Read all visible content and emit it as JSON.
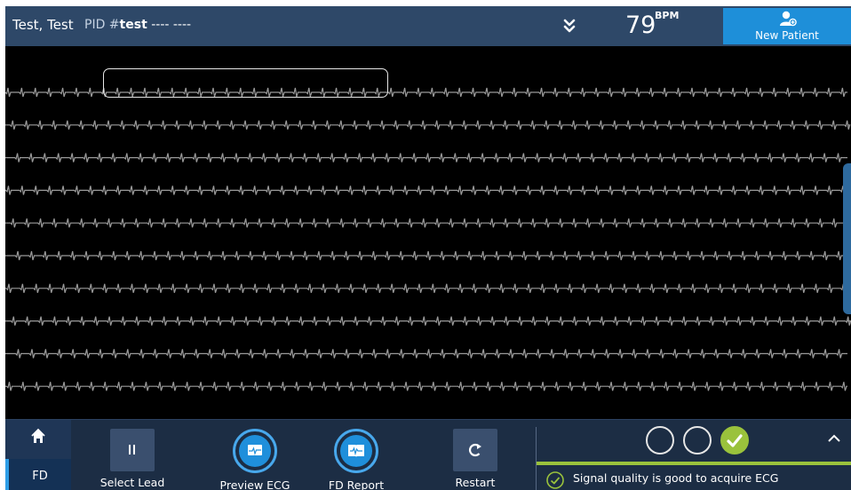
{
  "header": {
    "patient_name": "Test, Test",
    "pid_label": "PID #",
    "pid_value": "test",
    "pid_placeholder": " ---- ----",
    "heart_rate": "79",
    "heart_rate_unit": "BPM",
    "new_patient_label": "New Patient"
  },
  "ecg": {
    "lead_count": 10,
    "trace_color": "#9a9a9a"
  },
  "toolbar": {
    "fd_label": "FD",
    "select_lead_label": "Select Lead",
    "preview_ecg_label": "Preview ECG",
    "fd_report_label": "FD Report",
    "restart_label": "Restart"
  },
  "signal_quality": {
    "message": "Signal quality is good to acquire ECG",
    "indicators": [
      "empty",
      "empty",
      "good"
    ],
    "good_color": "#9ac23c"
  },
  "colors": {
    "header_bg": "#2e4868",
    "accent": "#1e8fd9",
    "toolbar_bg": "#1c2d44"
  }
}
